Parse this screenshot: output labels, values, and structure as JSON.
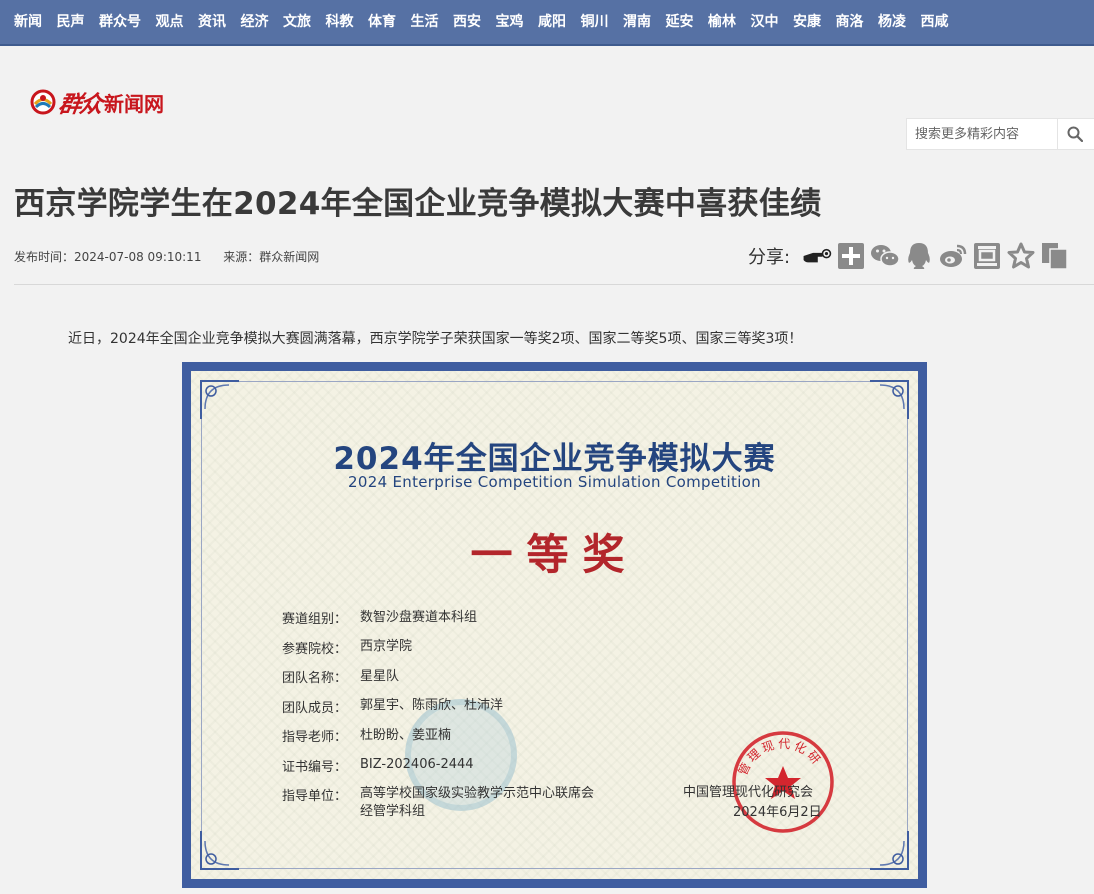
{
  "nav": {
    "items": [
      "新闻",
      "民声",
      "群众号",
      "观点",
      "资讯",
      "经济",
      "文旅",
      "科教",
      "体育",
      "生活",
      "西安",
      "宝鸡",
      "咸阳",
      "铜川",
      "渭南",
      "延安",
      "榆林",
      "汉中",
      "安康",
      "商洛",
      "杨凌",
      "西咸"
    ]
  },
  "logo": {
    "script": "群众",
    "text": "新闻网"
  },
  "search": {
    "placeholder": "搜索更多精彩内容",
    "icon": "search-icon"
  },
  "article": {
    "title": "西京学院学生在2024年全国企业竞争模拟大赛中喜获佳绩",
    "publish_time": "发布时间：2024-07-08 09:10:11",
    "source": "来源：群众新闻网",
    "lead": "近日，2024年全国企业竞争模拟大赛圆满落幕，西京学院学子荣获国家一等奖2项、国家二等奖5项、国家三等奖3项！"
  },
  "share": {
    "label": "分享:",
    "icons": [
      "share-hand-icon",
      "plus-icon",
      "wechat-icon",
      "qq-icon",
      "weibo-icon",
      "douban-icon",
      "favorite-icon",
      "copy-icon"
    ]
  },
  "certificate": {
    "title_cn": "2024年全国企业竞争模拟大赛",
    "title_en": "2024 Enterprise Competition Simulation Competition",
    "award": "一等奖",
    "rows": [
      {
        "key": "赛道组别：",
        "value": "数智沙盘赛道本科组"
      },
      {
        "key": "参赛院校：",
        "value": "西京学院"
      },
      {
        "key": "团队名称：",
        "value": "星星队"
      },
      {
        "key": "团队成员：",
        "value": "郭星宇、陈雨欣、杜沛洋"
      },
      {
        "key": "指导老师：",
        "value": "杜盼盼、姜亚楠"
      },
      {
        "key": "证书编号：",
        "value": "BIZ-202406-2444"
      },
      {
        "key": "指导单位：",
        "value": "高等学校国家级实验教学示范中心联席会",
        "value2": "经管学科组"
      }
    ],
    "issuer": "中国管理现代化研究会",
    "date": "2024年6月2日",
    "seal_text": "管理现代化研"
  },
  "colors": {
    "nav_bg": "#5671a4",
    "brand_red": "#c8161d",
    "cert_border": "#3f5da0",
    "cert_title": "#24457f",
    "award_red": "#b3262b"
  }
}
